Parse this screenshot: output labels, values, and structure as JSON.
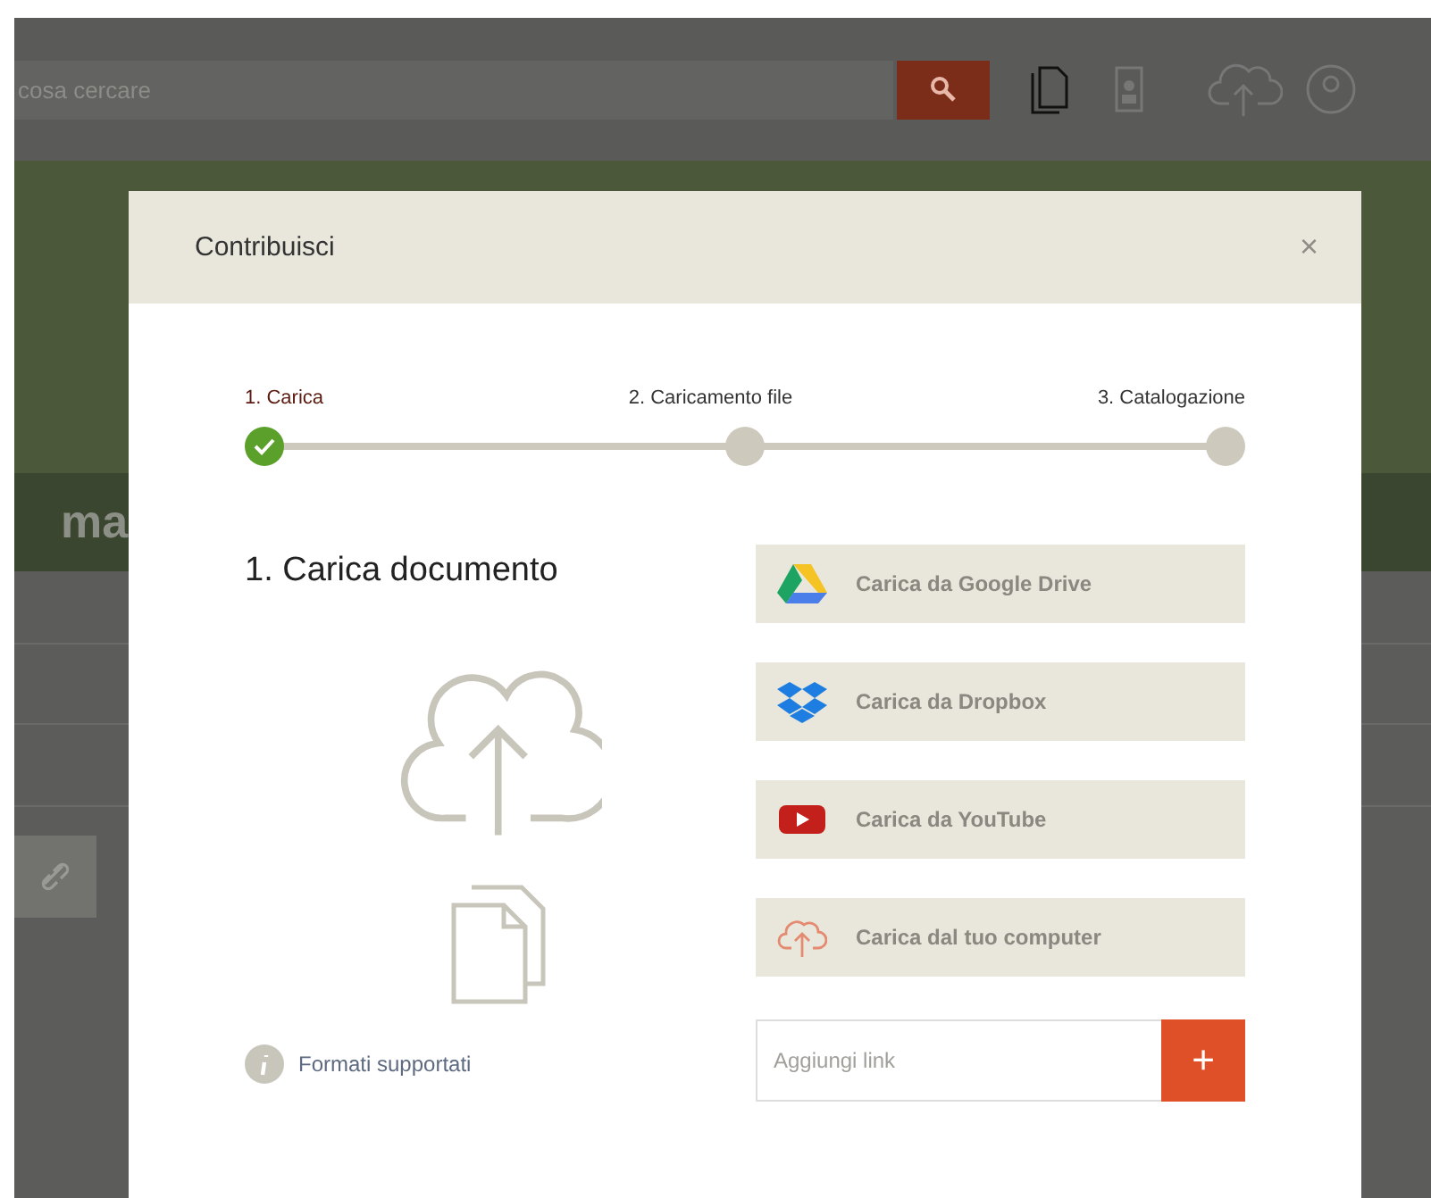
{
  "search": {
    "placeholder": "cosa cercare"
  },
  "page_heading": "ma",
  "modal": {
    "title": "Contribuisci",
    "close": "×",
    "steps": [
      {
        "label": "1. Carica",
        "done": true
      },
      {
        "label": "2. Caricamento file",
        "done": false
      },
      {
        "label": "3. Catalogazione",
        "done": false
      }
    ],
    "heading": "1. Carica documento",
    "formats_link": "Formati supportati",
    "sources": [
      {
        "kind": "drive",
        "label": "Carica da Google Drive"
      },
      {
        "kind": "dropbox",
        "label": "Carica da Dropbox"
      },
      {
        "kind": "youtube",
        "label": "Carica da YouTube"
      },
      {
        "kind": "computer",
        "label": "Carica dal tuo computer"
      }
    ],
    "link_field": {
      "placeholder": "Aggiungi link"
    },
    "add_button": "+"
  }
}
